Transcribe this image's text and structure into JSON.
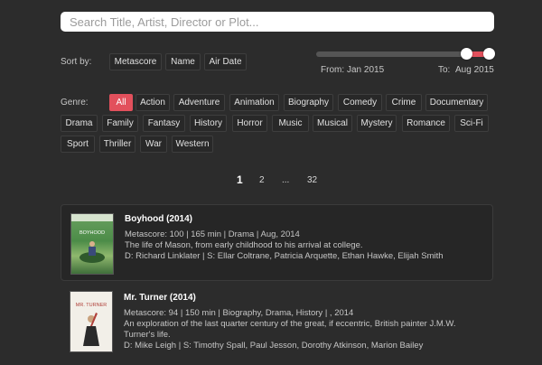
{
  "search": {
    "placeholder": "Search Title, Artist, Director or Plot..."
  },
  "sort": {
    "label": "Sort by:",
    "options": [
      "Metascore",
      "Name",
      "Air Date"
    ]
  },
  "date_range": {
    "from_label": "From:",
    "from_value": "Jan 2015",
    "to_label": "To:",
    "to_value": "Aug 2015"
  },
  "genre": {
    "label": "Genre:",
    "options": [
      "All",
      "Action",
      "Adventure",
      "Animation",
      "Biography",
      "Comedy",
      "Crime",
      "Documentary",
      "Drama",
      "Family",
      "Fantasy",
      "History",
      "Horror",
      "Music",
      "Musical",
      "Mystery",
      "Romance",
      "Sci-Fi",
      "Sport",
      "Thriller",
      "War",
      "Western"
    ],
    "selected": "All"
  },
  "pagination": {
    "current": "1",
    "next": "2",
    "ellipsis": "...",
    "last": "32"
  },
  "movies": [
    {
      "title": "Boyhood (2014)",
      "meta": "Metascore: 100 | 165 min | Drama | Aug, 2014",
      "plot": "The life of Mason, from early childhood to his arrival at college.",
      "credits": "D: Richard Linklater | S: Ellar Coltrane, Patricia Arquette, Ethan Hawke, Elijah Smith",
      "poster_text": "BOYHOOD"
    },
    {
      "title": "Mr. Turner (2014)",
      "meta": "Metascore: 94 | 150 min | Biography, Drama, History | , 2014",
      "plot": "An exploration of the last quarter century of the great, if eccentric, British painter J.M.W. Turner's life.",
      "credits": "D: Mike Leigh | S: Timothy Spall, Paul Jesson, Dorothy Atkinson, Marion Bailey",
      "poster_text": "MR. TURNER"
    }
  ],
  "colors": {
    "accent": "#e2505c",
    "background": "#2c2c2c"
  }
}
